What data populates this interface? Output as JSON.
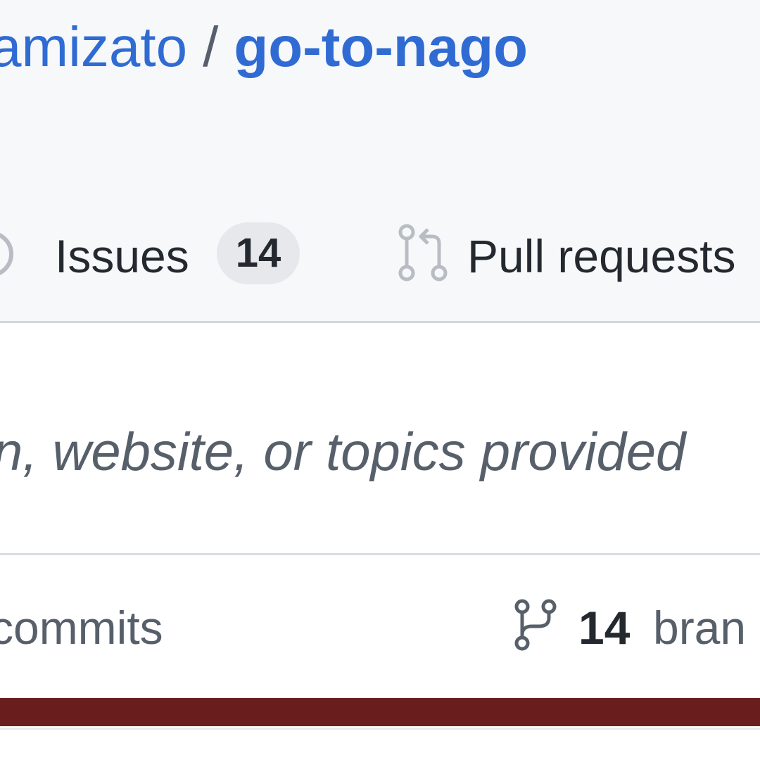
{
  "header": {
    "owner": "amizato",
    "separator": "/",
    "repo": "go-to-nago"
  },
  "tabs": {
    "issues_label": "Issues",
    "issues_count": "14",
    "pull_requests_label": "Pull requests"
  },
  "about": {
    "description": "n, website, or topics provided"
  },
  "stats": {
    "commits_label": "commits",
    "branches_count": "14",
    "branches_label": "bran"
  },
  "icons": {
    "issues": "issue-opened-icon",
    "pull_requests": "git-pull-request-icon",
    "branches": "git-branch-icon"
  },
  "colors": {
    "link": "#2f6bd3",
    "language_bar": "#6a1d1d",
    "header_bg": "#f6f8fa",
    "counter_bg": "#e6e8eb"
  }
}
